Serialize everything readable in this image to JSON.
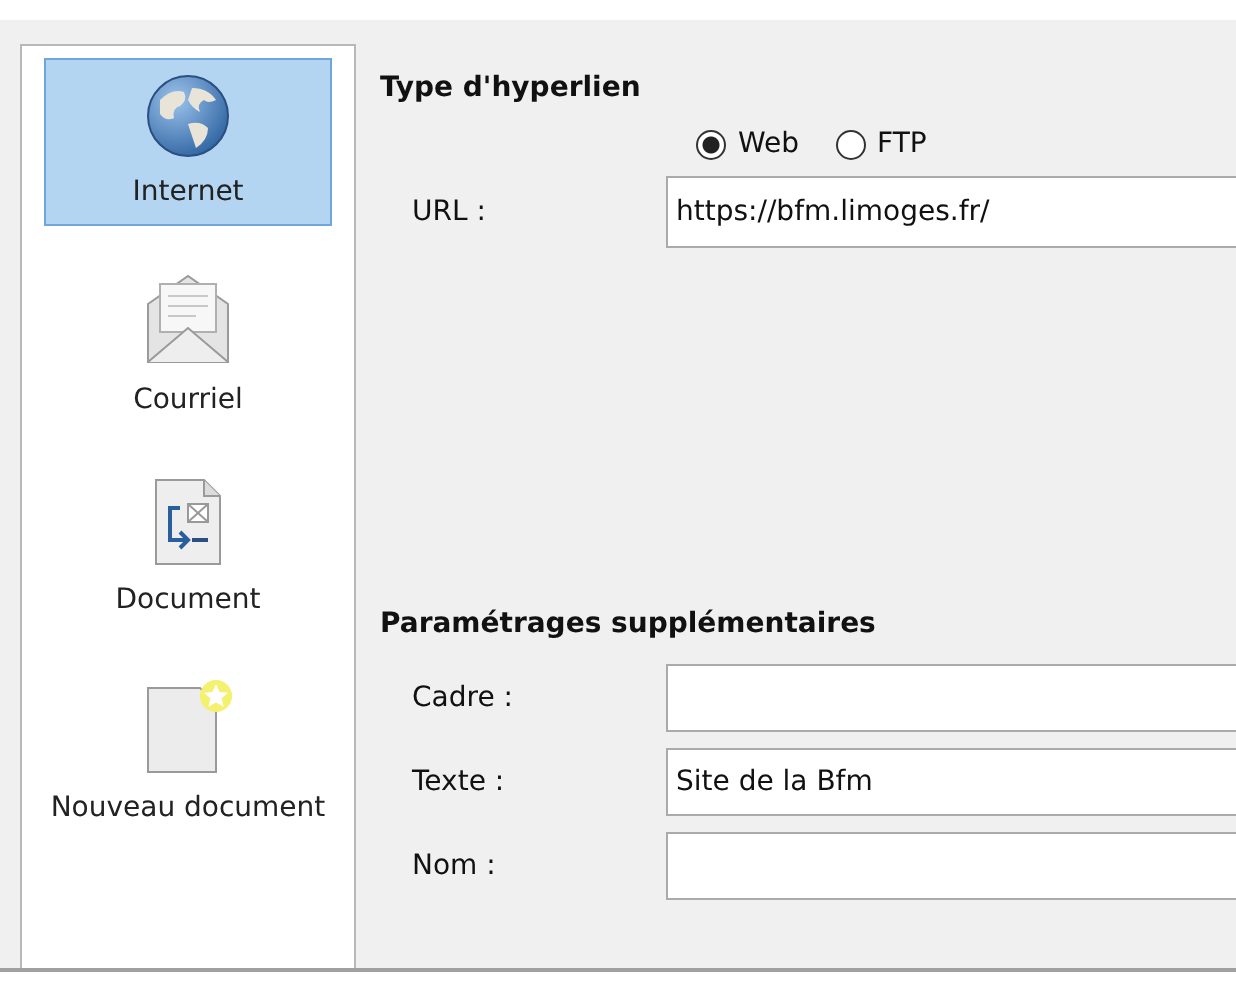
{
  "sidebar": {
    "items": [
      {
        "label": "Internet",
        "kind": "globe",
        "selected": true
      },
      {
        "label": "Courriel",
        "kind": "envelope",
        "selected": false
      },
      {
        "label": "Document",
        "kind": "document",
        "selected": false
      },
      {
        "label": "Nouveau document",
        "kind": "new-document",
        "selected": false
      }
    ]
  },
  "hyperlink_type": {
    "heading": "Type d'hyperlien",
    "options": [
      {
        "label": "Web",
        "selected": true
      },
      {
        "label": "FTP",
        "selected": false
      }
    ],
    "url": {
      "label": "URL :",
      "value": "https://bfm.limoges.fr/"
    }
  },
  "additional_settings": {
    "heading": "Paramétrages supplémentaires",
    "fields": [
      {
        "label": "Cadre :"
      },
      {
        "label": "Texte :",
        "value": "Site de la Bfm"
      },
      {
        "label": "Nom :"
      }
    ]
  }
}
